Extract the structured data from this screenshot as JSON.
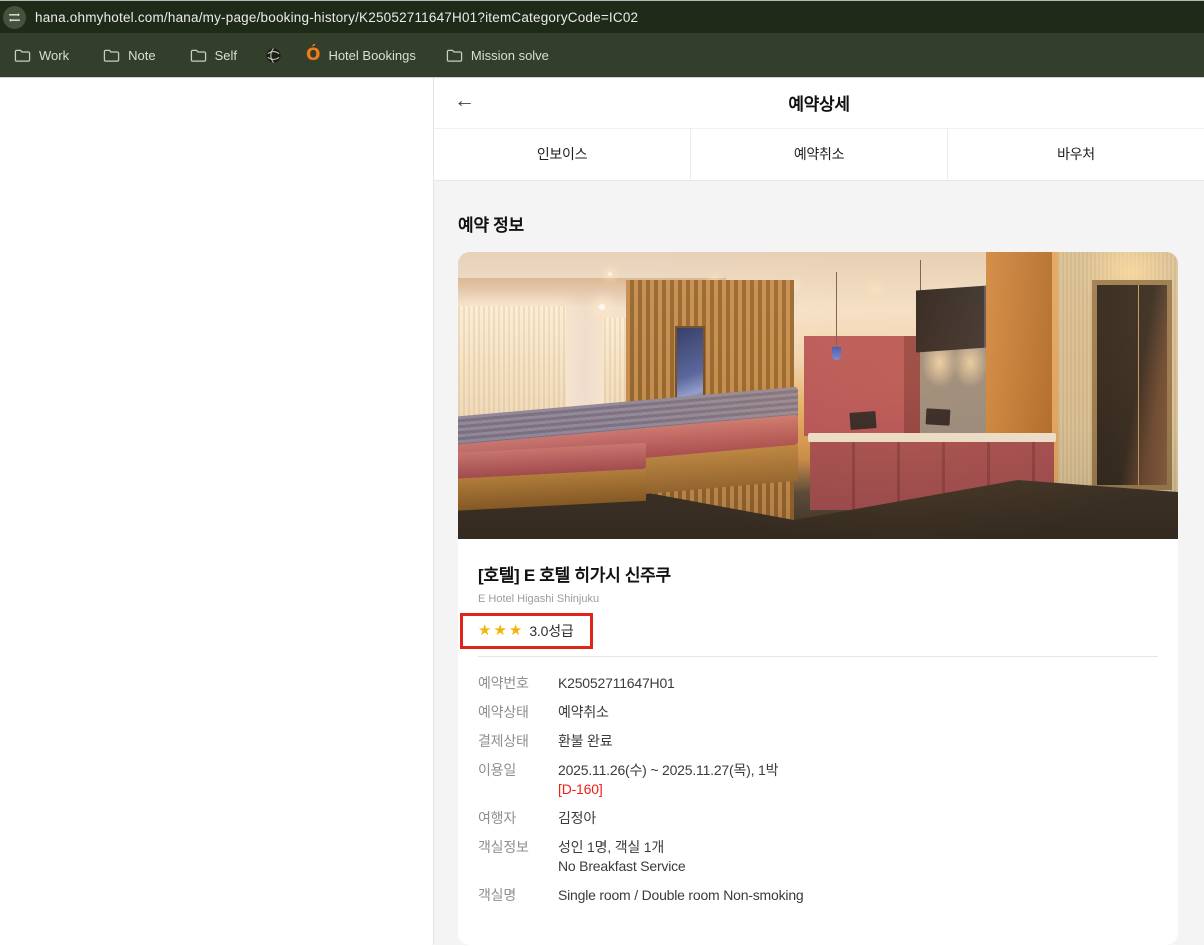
{
  "browser": {
    "url": "hana.ohmyhotel.com/hana/my-page/booking-history/K25052711647H01?itemCategoryCode=IC02",
    "bookmarks": [
      {
        "label": "Work",
        "icon": "folder-icon"
      },
      {
        "label": "Note",
        "icon": "folder-icon"
      },
      {
        "label": "Self",
        "icon": "folder-icon"
      },
      {
        "label": "",
        "icon": "globe-icon"
      },
      {
        "label": "Hotel Bookings",
        "icon": "ohmyhotel-icon"
      },
      {
        "label": "Mission solve",
        "icon": "folder-icon"
      }
    ]
  },
  "icons": {
    "back": "←",
    "ohmyhotel": "Ó"
  },
  "header": {
    "title": "예약상세"
  },
  "tabs": [
    {
      "label": "인보이스"
    },
    {
      "label": "예약취소"
    },
    {
      "label": "바우처"
    }
  ],
  "section": {
    "title": "예약 정보"
  },
  "hotel": {
    "name_ko": "[호텔] E 호텔 히가시 신주쿠",
    "name_en": "E Hotel Higashi Shinjuku",
    "star_count": 3,
    "stars": "★★★",
    "rating_label": "3.0성급"
  },
  "details": [
    {
      "label": "예약번호",
      "value": "K25052711647H01"
    },
    {
      "label": "예약상태",
      "value": "예약취소"
    },
    {
      "label": "결제상태",
      "value": "환불 완료"
    },
    {
      "label": "이용일",
      "value": "2025.11.26(수) ~ 2025.11.27(목), 1박",
      "value2": "[D-160]"
    },
    {
      "label": "여행자",
      "value": "김정아"
    },
    {
      "label": "객실정보",
      "value": "성인 1명, 객실 1개",
      "value2": "No Breakfast Service"
    },
    {
      "label": "객실명",
      "value": "Single room / Double room Non-smoking"
    }
  ],
  "colors": {
    "chrome_url_bar": "#202a19",
    "chrome_bookmarks_bar": "#333e2b",
    "page_bg": "#f4f4f4",
    "card_bg": "#ffffff",
    "star_gold": "#f6b40a",
    "annotation_red": "#e2231a",
    "dday_red": "#f01e14",
    "bookmark_orange": "#ee7c1f"
  }
}
